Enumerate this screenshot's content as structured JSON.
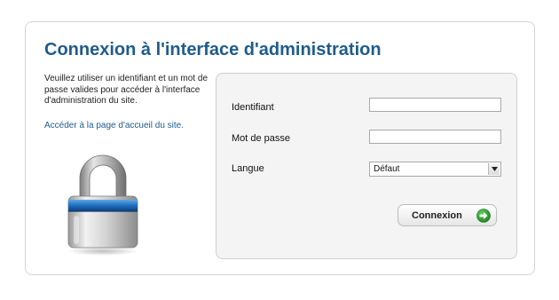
{
  "page": {
    "title": "Connexion à l'interface d'administration",
    "intro": "Veuillez utiliser un identifiant et un mot de passe valides pour accéder à l'interface d'administration du site.",
    "home_link": "Accéder à la page d'accueil du site."
  },
  "form": {
    "username_label": "Identifiant",
    "username_value": "",
    "password_label": "Mot de passe",
    "password_value": "",
    "language_label": "Langue",
    "language_selected": "Défaut",
    "submit_label": "Connexion",
    "submit_icon": "arrow-right-circle-icon"
  },
  "illustration": {
    "icon": "padlock-icon"
  },
  "colors": {
    "title": "#1f5c8a",
    "link": "#1f5c8a",
    "panel_background": "#f4f4f4",
    "submit_icon_green": "#2e9a2e"
  }
}
